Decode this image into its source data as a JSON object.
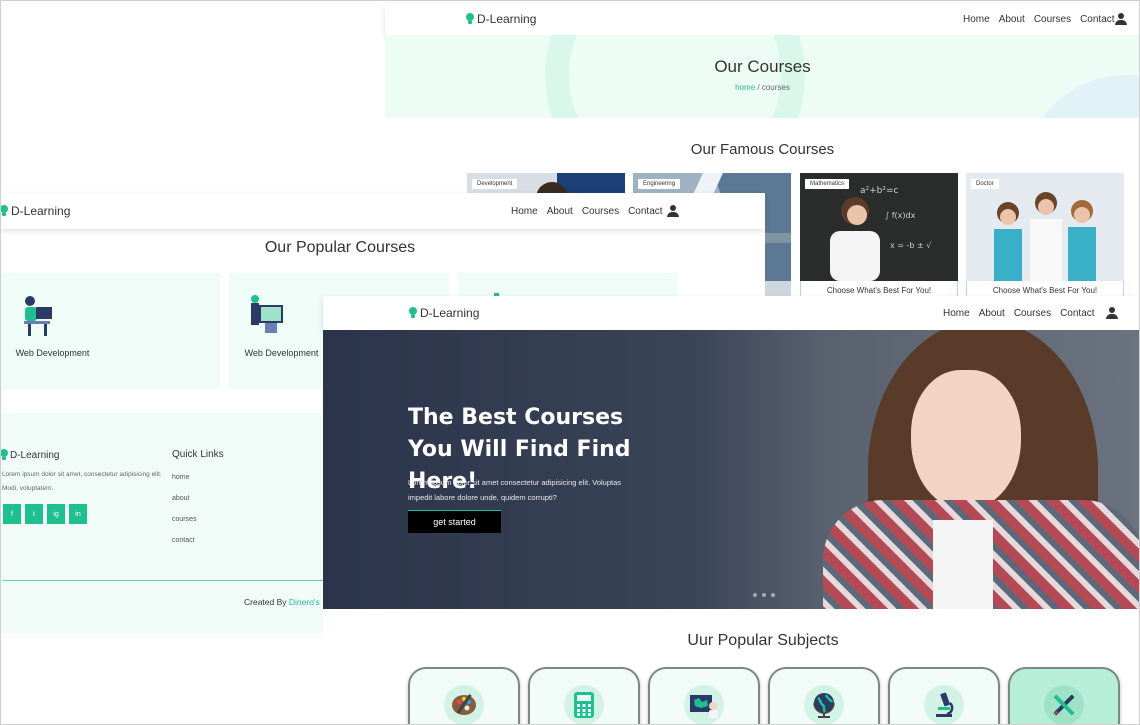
{
  "brand": "D-Learning",
  "nav": [
    "Home",
    "About",
    "Courses",
    "Contact"
  ],
  "courses_page": {
    "title": "Our Courses",
    "breadcrumb_home": "home",
    "breadcrumb_sep": " / ",
    "breadcrumb_current": "courses",
    "famous_title": "Our Famous Courses",
    "cards": [
      {
        "tag": "Development",
        "caption": ""
      },
      {
        "tag": "Engineering",
        "caption": ""
      },
      {
        "tag": "Mathematics",
        "caption": "Choose What's Best For You!"
      },
      {
        "tag": "Doctor",
        "caption": "Choose What's Best For You!"
      }
    ]
  },
  "popular_page": {
    "title": "Our Popular Courses",
    "cards": [
      {
        "label": "Web Development"
      },
      {
        "label": "Web Development"
      }
    ],
    "footer": {
      "brand": "D-Learning",
      "text": "Lorem ipsum dolor sit amet, consectetur adipisicing elit. Modi, voluptatem.",
      "socials": [
        "f",
        "t",
        "ig",
        "in"
      ],
      "quick_title": "Quick Links",
      "quick_links": [
        "home",
        "about",
        "courses",
        "contact"
      ],
      "created_prefix": "Created By ",
      "created_name": "Dinero's"
    }
  },
  "home_page": {
    "hero_title": "The Best Courses You Will Find Find Here!",
    "hero_text": "Lorem ipsum dolor sit amet consectetur adipisicing elit. Voluptas impedit labore dolore unde, quidem corrupti?",
    "cta": "get started",
    "subjects_title": "Uur Popular Subjects",
    "subjects": [
      "art-palette-icon",
      "calculator-icon",
      "map-icon",
      "globe-icon",
      "microscope-icon",
      "tools-icon"
    ]
  },
  "colors": {
    "accent": "#1fbf8f",
    "mint": "#effcf7",
    "hero": "#2b344a"
  }
}
